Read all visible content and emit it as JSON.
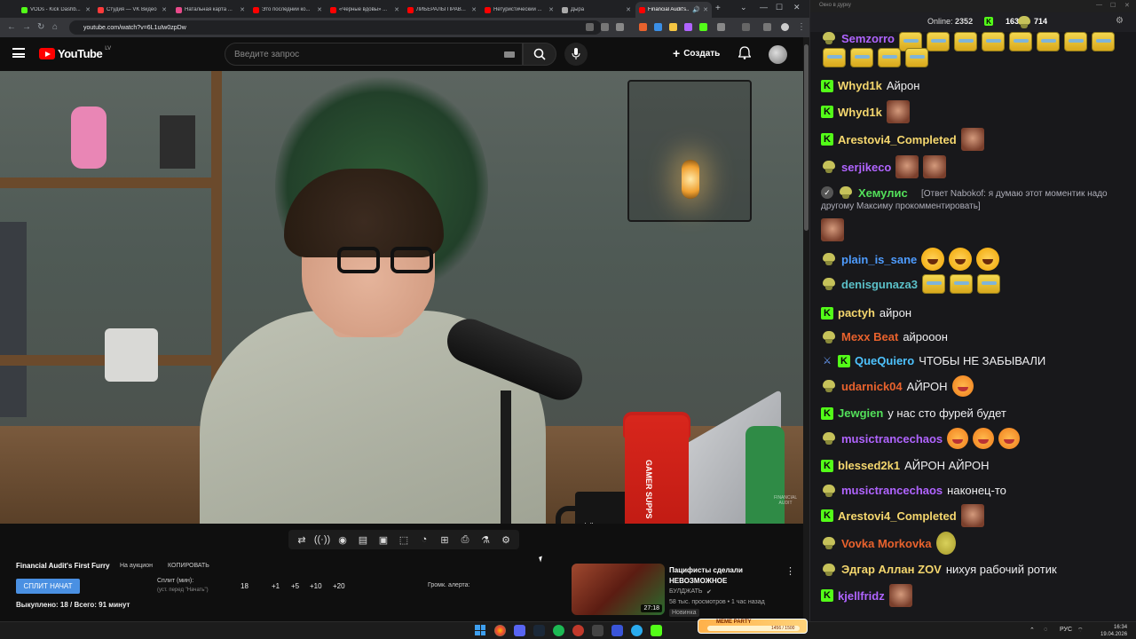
{
  "browser": {
    "tabs": [
      {
        "label": "VODs - Kick Dashb...",
        "color": "#53fc18"
      },
      {
        "label": "Студия — VK Видео",
        "color": "#ff3b3b"
      },
      {
        "label": "Натальная карта ...",
        "color": "#e84a8a"
      },
      {
        "label": "Это последний ко...",
        "color": "#ff0000"
      },
      {
        "label": "«Черные вдовы» ...",
        "color": "#ff0000"
      },
      {
        "label": "ЛИБЕРАЛЫ ПРАВ...",
        "color": "#ff0000"
      },
      {
        "label": "Нетуристический ...",
        "color": "#ff0000"
      },
      {
        "label": "Дыра",
        "color": "#aaaaaa"
      },
      {
        "label": "Financial Audit's...",
        "color": "#ff0000"
      }
    ],
    "url": "youtube.com/watch?v=6L1uIw0zpDw",
    "new_tab": "+"
  },
  "youtube": {
    "logo_text": "YouTube",
    "country": "LV",
    "search_placeholder": "Введите запрос",
    "create_label": "Создать",
    "video_watermark": "FINANCIAL AUDIT"
  },
  "video_product_text": {
    "mug": "dollar",
    "shaker": "GAMER SUPPS"
  },
  "toolbar_icons": [
    "loop-icon",
    "audio-icon",
    "camera-eye-icon",
    "folder-icon",
    "frame-icon",
    "crop-icon",
    "speed-icon",
    "add-icon",
    "screenshot-icon",
    "flask-icon",
    "gear-icon"
  ],
  "auction": {
    "title": "Financial Audit's First Furry",
    "on_auction": "На аукцион",
    "copy": "КОПИРОВАТЬ",
    "split_button": "СПЛИТ НАЧАТ",
    "split_label": "Сплит (мин):",
    "split_hint": "(уст. перед \"Начать\")",
    "split_value": "18",
    "increments": [
      "+1",
      "+5",
      "+10",
      "+20"
    ],
    "alert_label": "Громк. алерта:",
    "bought_line": "Выкуплено: 18 / Всего: 91 минут"
  },
  "recommended": {
    "title": "Пацифисты сделали НЕВОЗМОЖНОЕ",
    "channel": "БУЛДЖАТЬ",
    "meta": "58 тыс. просмотров • 1 час назад",
    "badge": "Новинка",
    "duration": "27:18"
  },
  "chat": {
    "window_title": "Окно в дурку",
    "online_label": "Online:",
    "online_count": "2352",
    "kick_count": "1638",
    "pepe_count": "714",
    "messages": [
      {
        "user": "Semzorro",
        "color": "#b064ff",
        "badge": "pepe",
        "text": "",
        "emotes": "yellow"
      },
      {
        "user": "Whyd1k",
        "color": "#f5d76e",
        "badge": "kick",
        "text": "Айрон"
      },
      {
        "user": "Whyd1k",
        "color": "#f5d76e",
        "badge": "kick",
        "text": "",
        "emotes": "face"
      },
      {
        "user": "Arestovi4_Completed",
        "color": "#f5d76e",
        "badge": "kick",
        "text": "",
        "emotes": "face"
      },
      {
        "user": "serjikeco",
        "color": "#b064ff",
        "badge": "pepe",
        "text": "",
        "emotes": "face2"
      },
      {
        "user": "Хемулис",
        "color": "#53e05a",
        "badge": "pepe",
        "text": "[Ответ Nabokof: я думаю этот моментик надо другому Максиму прокомментировать]"
      },
      {
        "user": "plain_is_sane",
        "color": "#4e9cff",
        "badge": "pepe",
        "text": "",
        "emotes": "laugh"
      },
      {
        "user": "denisgunaza3",
        "color": "#5bc0c8",
        "badge": "pepe",
        "text": "",
        "emotes": "yellow3"
      },
      {
        "user": "pactyh",
        "color": "#f5d76e",
        "badge": "kick",
        "text": "айрон"
      },
      {
        "user": "Mexx Beat",
        "color": "#e8622d",
        "badge": "pepe",
        "text": "айрооон"
      },
      {
        "user": "QueQuiero",
        "color": "#4ec3ff",
        "badge": "kick",
        "text": "ЧТОБЫ НЕ ЗАБЫВАЛИ"
      },
      {
        "user": "udarnick04",
        "color": "#e8622d",
        "badge": "pepe",
        "text": "АЙРОН",
        "emotes": "star"
      },
      {
        "user": "Jewgien",
        "color": "#53e05a",
        "badge": "kick",
        "text": "у нас сто фурей будет"
      },
      {
        "user": "musictrancechaos",
        "color": "#b064ff",
        "badge": "pepe",
        "text": "",
        "emotes": "star3"
      },
      {
        "user": "blessed2k1",
        "color": "#f5d76e",
        "badge": "kick",
        "text": "АЙРОН АЙРОН"
      },
      {
        "user": "musictrancechaos",
        "color": "#b064ff",
        "badge": "pepe",
        "text": "наконец-то"
      },
      {
        "user": "Arestovi4_Completed",
        "color": "#f5d76e",
        "badge": "kick",
        "text": "",
        "emotes": "face"
      },
      {
        "user": "Vovka Morkovka",
        "color": "#e8622d",
        "badge": "pepe",
        "text": "",
        "emotes": "potato"
      },
      {
        "user": "Эдгар Аллан ZOV",
        "color": "#f5d76e",
        "badge": "pepe",
        "text": "нихуя рабочий ротик"
      },
      {
        "user": "kjellfridz",
        "color": "#b064ff",
        "badge": "kick",
        "text": "",
        "emotes": "face"
      }
    ]
  },
  "meme_party": {
    "label": "MEME PARTY",
    "value": "1456 / 1500"
  },
  "taskbar": {
    "lang": "РУС",
    "time": "16:34",
    "date": "19.04.2026"
  }
}
